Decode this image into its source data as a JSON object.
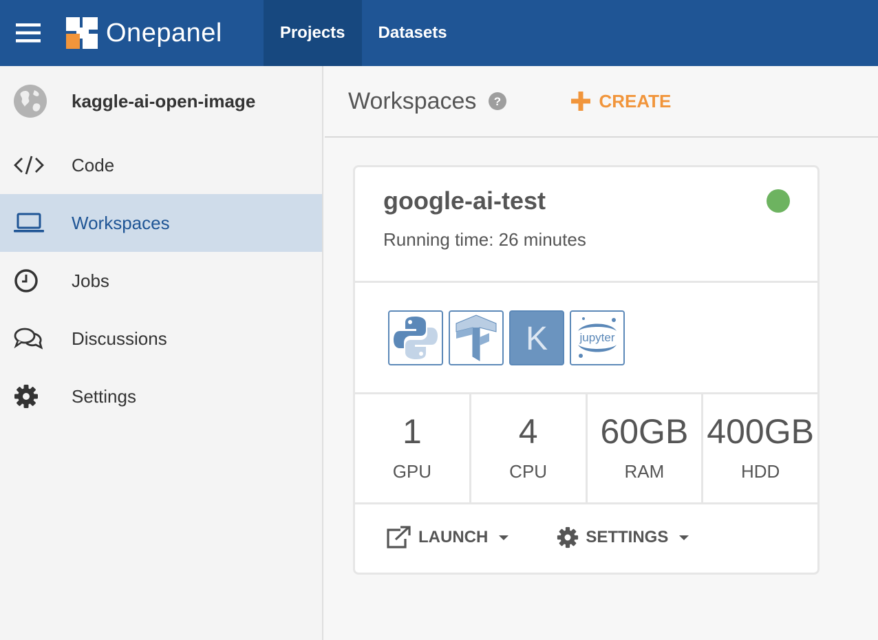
{
  "header": {
    "logo_text": "Onepanel",
    "nav": [
      {
        "label": "Projects",
        "active": true
      },
      {
        "label": "Datasets",
        "active": false
      }
    ]
  },
  "sidebar": {
    "project_name": "kaggle-ai-open-image",
    "items": [
      {
        "label": "Code",
        "icon": "code-icon"
      },
      {
        "label": "Workspaces",
        "icon": "laptop-icon",
        "active": true
      },
      {
        "label": "Jobs",
        "icon": "clock-icon"
      },
      {
        "label": "Discussions",
        "icon": "comments-icon"
      },
      {
        "label": "Settings",
        "icon": "gear-icon"
      }
    ]
  },
  "main": {
    "title": "Workspaces",
    "create_label": "CREATE"
  },
  "workspace": {
    "name": "google-ai-test",
    "running_time": "Running time: 26 minutes",
    "status_color": "#6db360",
    "frameworks": [
      "python-icon",
      "tensorflow-icon",
      "keras-icon",
      "jupyter-icon"
    ],
    "jupyter_label": "jupyter",
    "keras_letter": "K",
    "specs": [
      {
        "value": "1",
        "label": "GPU"
      },
      {
        "value": "4",
        "label": "CPU"
      },
      {
        "value": "60GB",
        "label": "RAM"
      },
      {
        "value": "400GB",
        "label": "HDD"
      }
    ],
    "actions": {
      "launch": "LAUNCH",
      "settings": "SETTINGS"
    }
  },
  "colors": {
    "topbar": "#1f5595",
    "accent": "#f1953b",
    "sidebar_active": "#cfdcea"
  }
}
